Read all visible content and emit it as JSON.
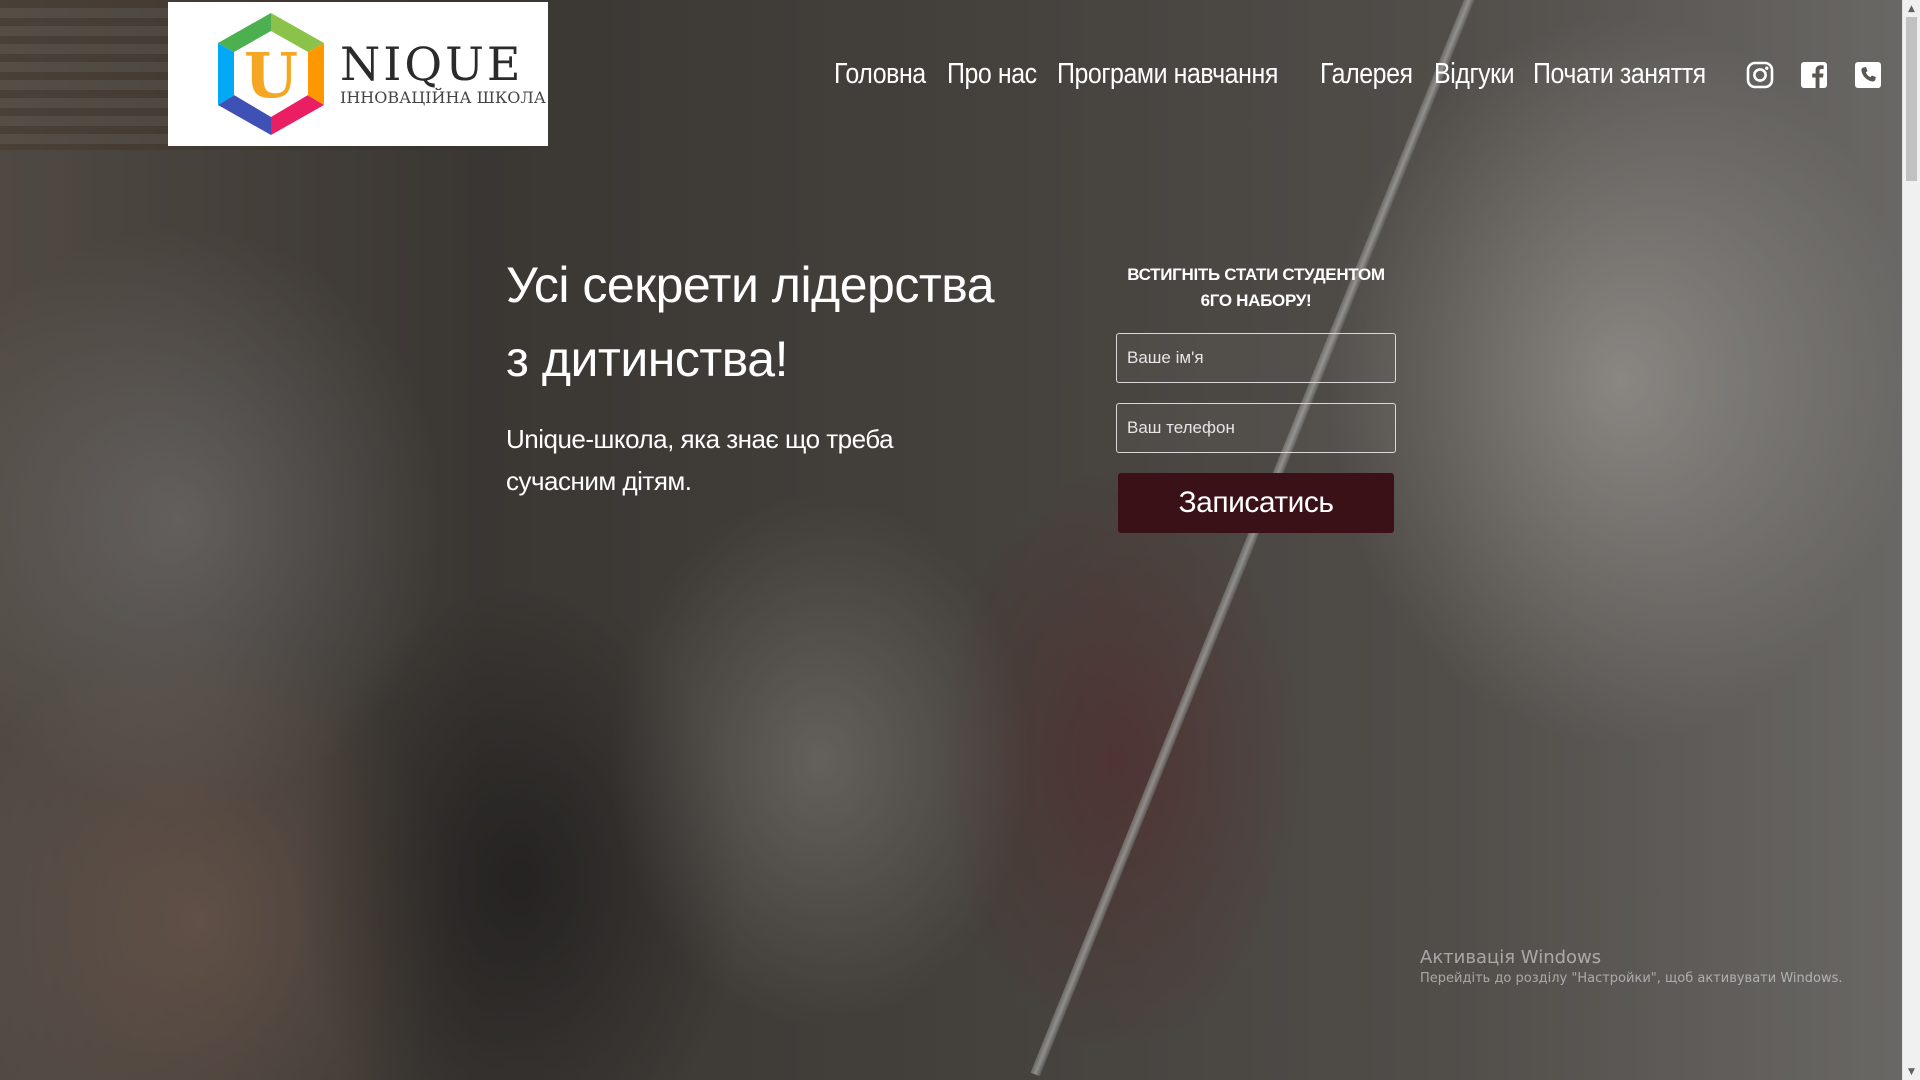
{
  "header": {
    "logo_word": "NIQUE",
    "logo_subtitle": "ІННОВАЦІЙНА ШКОЛА",
    "logo_letter": "U"
  },
  "nav": {
    "items": [
      {
        "label": "Головна"
      },
      {
        "label": "Про нас"
      },
      {
        "label": "Програми навчання"
      },
      {
        "label": "Галерея"
      },
      {
        "label": "Відгуки"
      },
      {
        "label": "Почати заняття"
      }
    ],
    "icons": [
      "instagram-icon",
      "facebook-icon",
      "phone-icon"
    ]
  },
  "hero": {
    "title": "Усі секрети лідерства з дитинства!",
    "subtitle": "Unique-школа, яка знає що треба сучасним дітям."
  },
  "form": {
    "heading": "ВСТИГНІТЬ СТАТИ СТУДЕНТОМ 6ГО НАБОРУ!",
    "name_placeholder": "Ваше ім'я",
    "phone_placeholder": "Ваш телефон",
    "submit_label": "Записатись"
  },
  "watermark": {
    "title": "Активація Windows",
    "text": "Перейдіть до розділу \"Настройки\", щоб активувати Windows."
  },
  "colors": {
    "button_bg": "#3a1116",
    "text": "#ffffff",
    "logo_bg": "#ffffff"
  }
}
